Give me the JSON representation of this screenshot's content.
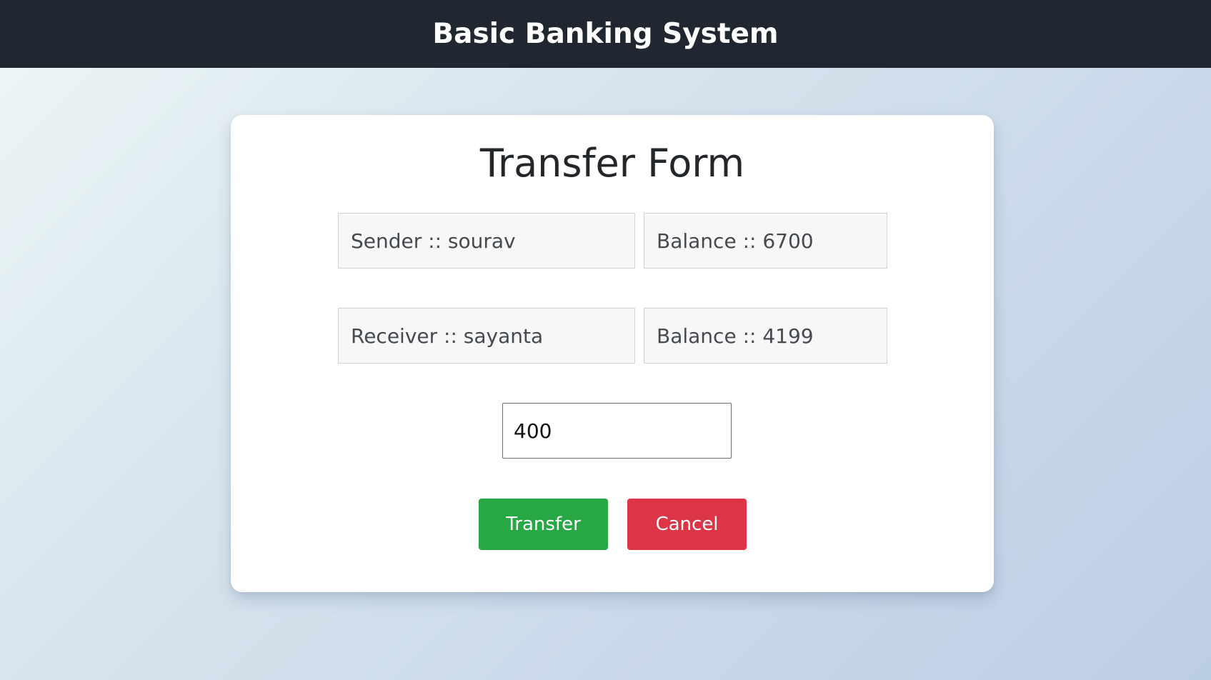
{
  "header": {
    "title": "Basic Banking System"
  },
  "form": {
    "title": "Transfer Form",
    "sender_field": "Sender :: sourav",
    "sender_balance_field": "Balance :: 6700",
    "receiver_field": "Receiver :: sayanta",
    "receiver_balance_field": "Balance :: 4199",
    "amount_value": "400",
    "transfer_label": "Transfer",
    "cancel_label": "Cancel"
  },
  "colors": {
    "navbar": "#212731",
    "transfer_button": "#28a745",
    "cancel_button": "#dc3545"
  }
}
